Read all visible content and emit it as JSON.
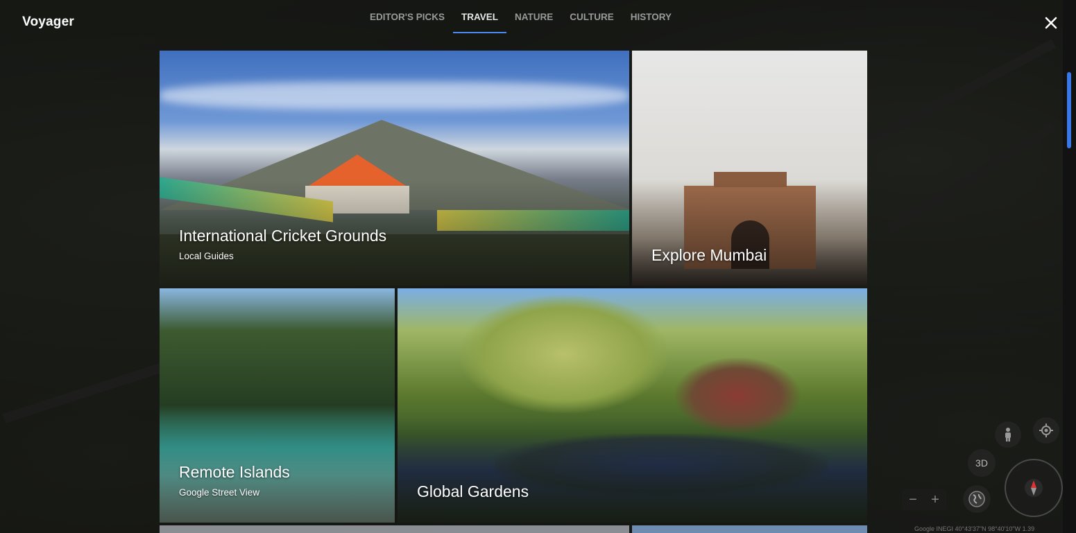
{
  "app": {
    "title": "Voyager"
  },
  "tabs": [
    {
      "label": "EDITOR'S PICKS",
      "active": false
    },
    {
      "label": "TRAVEL",
      "active": true
    },
    {
      "label": "NATURE",
      "active": false
    },
    {
      "label": "CULTURE",
      "active": false
    },
    {
      "label": "HISTORY",
      "active": false
    }
  ],
  "cards": {
    "cricket": {
      "title": "International Cricket Grounds",
      "subtitle": "Local Guides"
    },
    "mumbai": {
      "title": "Explore Mumbai"
    },
    "islands": {
      "title": "Remote Islands",
      "subtitle": "Google Street View"
    },
    "gardens": {
      "title": "Global Gardens"
    }
  },
  "map_controls": {
    "three_d_label": "3D",
    "zoom_out": "−",
    "zoom_in": "+",
    "attribution": "Google   INEGI    40°43'37\"N 98°40'10\"W   1.39"
  },
  "colors": {
    "accent": "#4c8bf5",
    "scrollbar": "#3b78e7"
  }
}
